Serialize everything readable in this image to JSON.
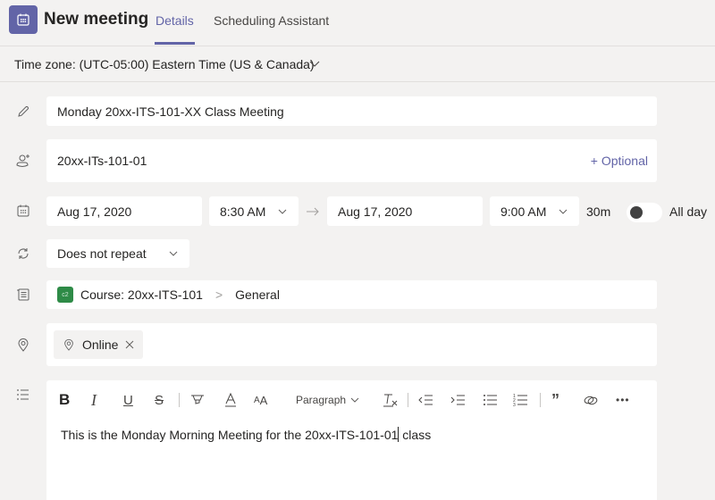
{
  "header": {
    "title": "New meeting",
    "tabs": [
      {
        "label": "Details",
        "active": true
      },
      {
        "label": "Scheduling Assistant",
        "active": false
      }
    ],
    "accent_color": "#6264a7"
  },
  "timezone": {
    "label": "Time zone: (UTC-05:00) Eastern Time (US & Canada)"
  },
  "form": {
    "title_value": "Monday 20xx-ITS-101-XX Class Meeting",
    "attendees_value": "20xx-ITs-101-01",
    "optional_label": "+ Optional",
    "start_date": "Aug 17, 2020",
    "start_time": "8:30 AM",
    "end_date": "Aug 17, 2020",
    "end_time": "9:00 AM",
    "duration": "30m",
    "all_day_label": "All day",
    "all_day_on": false,
    "repeat": "Does not repeat",
    "channel": {
      "team_badge": "c2",
      "team_badge_color": "#2e8b47",
      "team": "Course: 20xx-ITS-101",
      "separator": ">",
      "channel": "General"
    },
    "location_chip": "Online"
  },
  "editor": {
    "toolbar": {
      "bold": "B",
      "italic": "I",
      "underline": "U",
      "strikethrough": "S",
      "paragraph": "Paragraph",
      "more": "•••"
    },
    "body_before_caret": "This is the Monday Morning Meeting for the 20xx-ITS-101-01",
    "body_after_caret": " class"
  }
}
